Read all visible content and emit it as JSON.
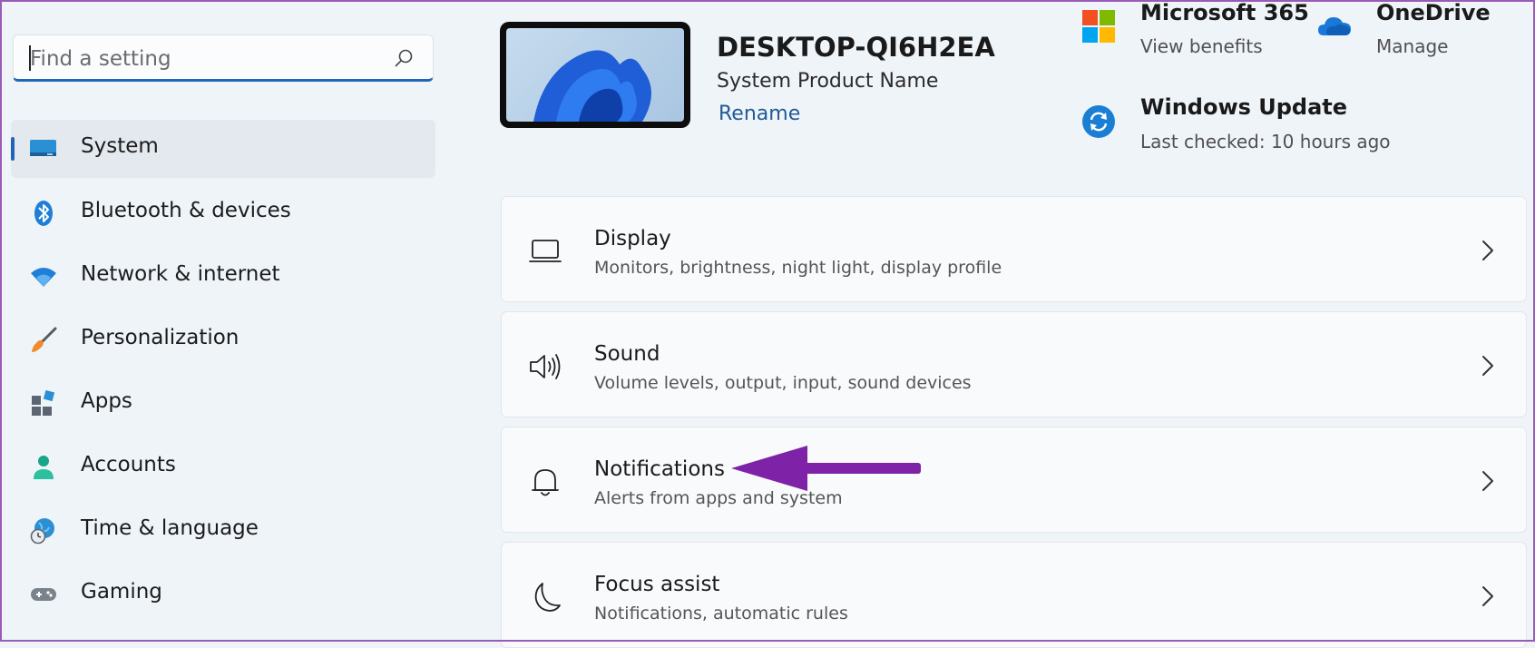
{
  "search": {
    "placeholder": "Find a setting"
  },
  "sidebar": {
    "items": [
      {
        "label": "System",
        "icon": "system-monitor-icon",
        "active": true
      },
      {
        "label": "Bluetooth & devices",
        "icon": "bluetooth-icon"
      },
      {
        "label": "Network & internet",
        "icon": "wifi-icon"
      },
      {
        "label": "Personalization",
        "icon": "brush-icon"
      },
      {
        "label": "Apps",
        "icon": "apps-icon"
      },
      {
        "label": "Accounts",
        "icon": "person-icon"
      },
      {
        "label": "Time & language",
        "icon": "globe-clock-icon"
      },
      {
        "label": "Gaming",
        "icon": "gamepad-icon"
      }
    ]
  },
  "device": {
    "name": "DESKTOP-QI6H2EA",
    "model": "System Product Name",
    "rename_label": "Rename"
  },
  "tiles": {
    "microsoft365": {
      "title": "Microsoft 365",
      "subtitle": "View benefits",
      "icon": "microsoft-logo-icon"
    },
    "onedrive": {
      "title": "OneDrive",
      "subtitle": "Manage",
      "icon": "cloud-icon"
    },
    "windows_update": {
      "title": "Windows Update",
      "subtitle": "Last checked: 10 hours ago",
      "icon": "sync-icon"
    }
  },
  "settings": [
    {
      "title": "Display",
      "subtitle": "Monitors, brightness, night light, display profile",
      "icon": "laptop-icon"
    },
    {
      "title": "Sound",
      "subtitle": "Volume levels, output, input, sound devices",
      "icon": "speaker-icon"
    },
    {
      "title": "Notifications",
      "subtitle": "Alerts from apps and system",
      "icon": "bell-icon"
    },
    {
      "title": "Focus assist",
      "subtitle": "Notifications, automatic rules",
      "icon": "moon-icon"
    }
  ],
  "colors": {
    "accent": "#1f66b8",
    "annotation_arrow": "#7e22a8",
    "background": "#eff4f9"
  }
}
